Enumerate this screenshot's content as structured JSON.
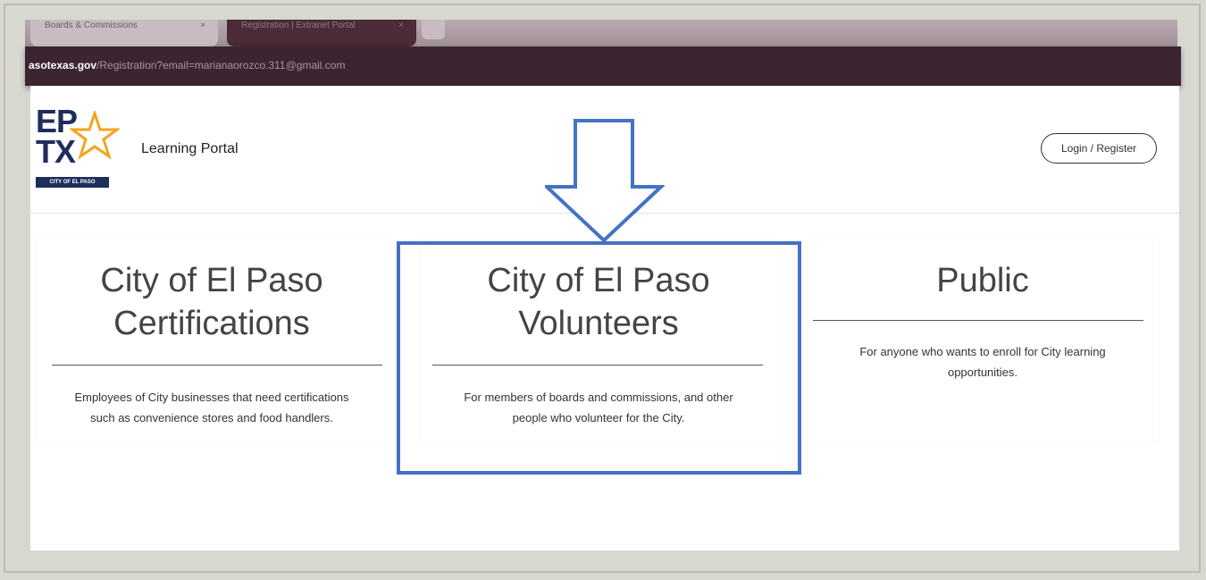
{
  "browser": {
    "tabs": [
      {
        "label": "Boards & Commissions",
        "close": "×"
      },
      {
        "label": "Registration | Extranet Portal",
        "close": "×"
      }
    ],
    "new_tab": "+",
    "url_domain": "asotexas.gov",
    "url_path": "/Registration?email=marianaorozco.311@gmail.com"
  },
  "header": {
    "logo_line1": "EP",
    "logo_line2": "TX",
    "logo_badge": "CITY OF EL PASO",
    "portal_title": "Learning Portal",
    "login_label": "Login / Register"
  },
  "cards": [
    {
      "title_line1": "City of El Paso",
      "title_line2": "Certifications",
      "desc_line1": "Employees of City businesses that need certifications",
      "desc_line2": "such as convenience stores and food handlers."
    },
    {
      "title_line1": "City of El Paso",
      "title_line2": "Volunteers",
      "desc_line1": "For members of boards and commissions, and other",
      "desc_line2": "people who volunteer for the City."
    },
    {
      "title_line1": "Public",
      "desc_line1": "For anyone who wants to enroll for City learning",
      "desc_line2": "opportunities."
    }
  ],
  "colors": {
    "annotation": "#4472c4",
    "brand_navy": "#1f2d5e",
    "brand_star": "#f2a51f",
    "chrome_dark": "#3c2530"
  }
}
